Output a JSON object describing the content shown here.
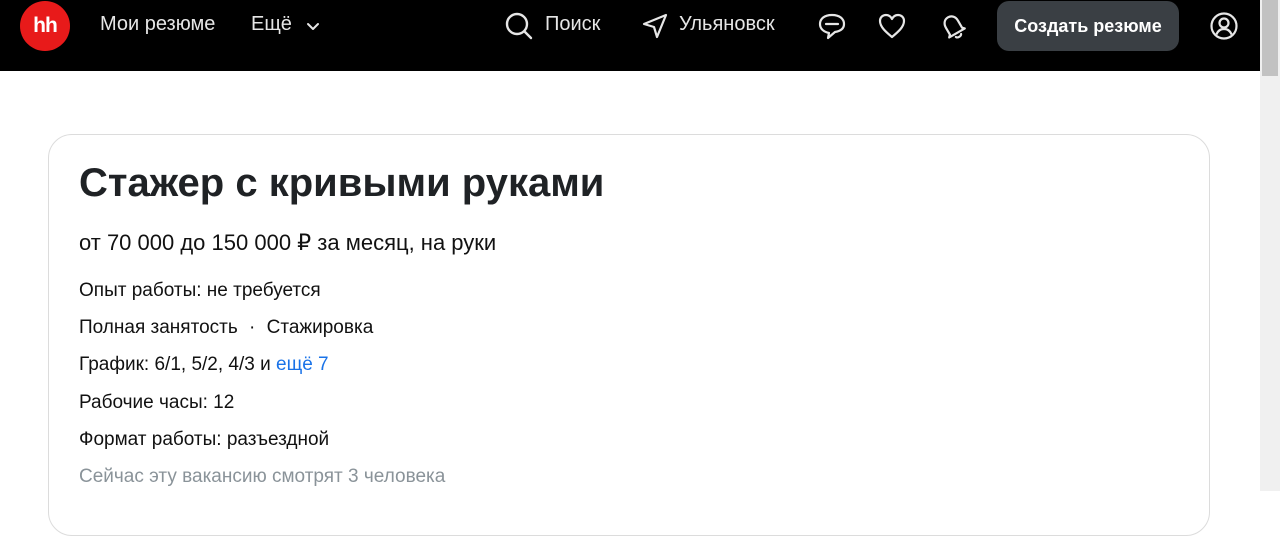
{
  "header": {
    "logo_text": "hh",
    "nav": {
      "my_resumes": "Мои резюме",
      "more": "Ещё"
    },
    "search_label": "Поиск",
    "location_label": "Ульяновск",
    "create_resume_label": "Создать резюме",
    "colors": {
      "background": "#000000",
      "logo": "#e81a1a",
      "button": "#3a3f44"
    }
  },
  "vacancy": {
    "title": "Стажер с кривыми руками",
    "salary": "от 70 000 до 150 000 ₽ за месяц, на руки",
    "experience": "Опыт работы: не требуется",
    "employment_full": "Полная занятость",
    "separator": "·",
    "employment_internship": "Стажировка",
    "schedule_prefix": "График: 6/1, 5/2, 4/3 и ",
    "schedule_more_link": "ещё 7",
    "hours": "Рабочие часы: 12",
    "work_format": "Формат работы: разъездной",
    "viewers": "Сейчас эту вакансию смотрят 3 человека",
    "link_color": "#1a73e8"
  },
  "icons": [
    "hh-logo",
    "chevron-down-icon",
    "search-icon",
    "location-arrow-icon",
    "chat-icon",
    "heart-icon",
    "bell-icon",
    "user-icon"
  ]
}
